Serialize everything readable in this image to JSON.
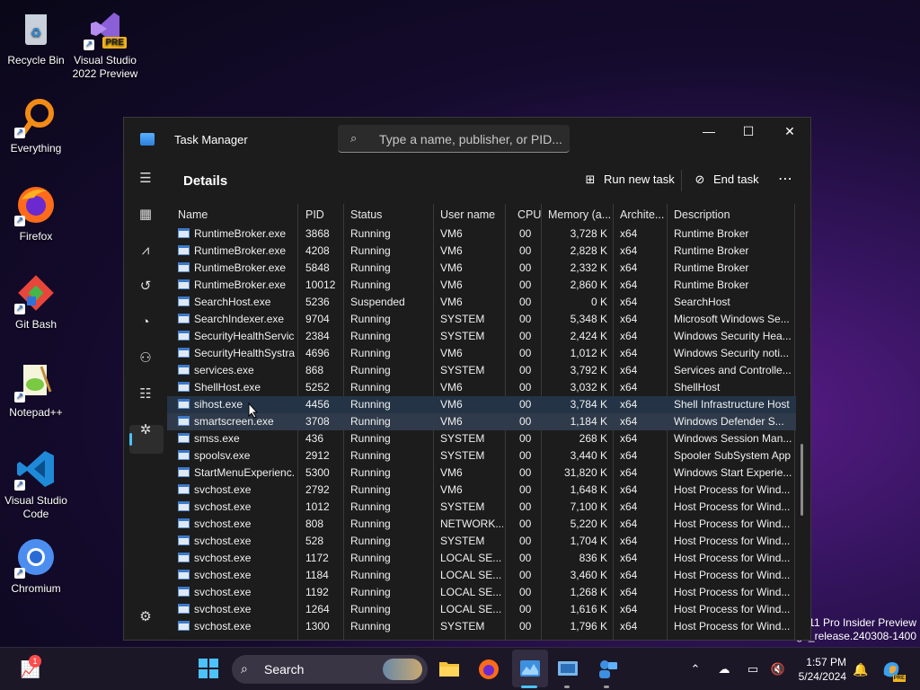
{
  "desktop": {
    "icons": [
      {
        "label": "Recycle Bin",
        "icon": "recycle-bin-icon"
      },
      {
        "label": "Visual Studio 2022 Preview",
        "icon": "visual-studio-preview-icon",
        "badge": "PRE"
      },
      {
        "label": "Everything",
        "icon": "everything-search-icon"
      },
      {
        "label": "Firefox",
        "icon": "firefox-icon"
      },
      {
        "label": "Git Bash",
        "icon": "git-bash-icon"
      },
      {
        "label": "Notepad++",
        "icon": "notepad-plus-plus-icon"
      },
      {
        "label": "Visual Studio Code",
        "icon": "vscode-icon"
      },
      {
        "label": "Chromium",
        "icon": "chromium-icon"
      }
    ],
    "watermark": {
      "line1": "11 Pro Insider Preview",
      "line2": "ge_release.240308-1400"
    }
  },
  "window": {
    "title": "Task Manager",
    "search_placeholder": "Type a name, publisher, or PID...",
    "controls": {
      "minimize": "—",
      "maximize": "☐",
      "close": "✕"
    }
  },
  "nav": {
    "items": [
      "hamburger-menu-icon",
      "processes-icon",
      "performance-icon",
      "app-history-icon",
      "startup-apps-icon",
      "users-icon",
      "details-icon",
      "services-icon"
    ],
    "active": "details-icon",
    "settings": "settings-icon"
  },
  "page": {
    "title": "Details",
    "run_new_task": "Run new task",
    "end_task": "End task",
    "more": "⋯"
  },
  "table": {
    "columns": [
      "Name",
      "PID",
      "Status",
      "User name",
      "CPU",
      "Memory (a...",
      "Archite...",
      "Description"
    ],
    "sort_column": "Name",
    "rows": [
      [
        "RuntimeBroker.exe",
        "3868",
        "Running",
        "VM6",
        "00",
        "3,728 K",
        "x64",
        "Runtime Broker"
      ],
      [
        "RuntimeBroker.exe",
        "4208",
        "Running",
        "VM6",
        "00",
        "2,828 K",
        "x64",
        "Runtime Broker"
      ],
      [
        "RuntimeBroker.exe",
        "5848",
        "Running",
        "VM6",
        "00",
        "2,332 K",
        "x64",
        "Runtime Broker"
      ],
      [
        "RuntimeBroker.exe",
        "10012",
        "Running",
        "VM6",
        "00",
        "2,860 K",
        "x64",
        "Runtime Broker"
      ],
      [
        "SearchHost.exe",
        "5236",
        "Suspended",
        "VM6",
        "00",
        "0 K",
        "x64",
        "SearchHost"
      ],
      [
        "SearchIndexer.exe",
        "9704",
        "Running",
        "SYSTEM",
        "00",
        "5,348 K",
        "x64",
        "Microsoft Windows Se..."
      ],
      [
        "SecurityHealthServic...",
        "2384",
        "Running",
        "SYSTEM",
        "00",
        "2,424 K",
        "x64",
        "Windows Security Hea..."
      ],
      [
        "SecurityHealthSystra...",
        "4696",
        "Running",
        "VM6",
        "00",
        "1,012 K",
        "x64",
        "Windows Security noti..."
      ],
      [
        "services.exe",
        "868",
        "Running",
        "SYSTEM",
        "00",
        "3,792 K",
        "x64",
        "Services and Controlle..."
      ],
      [
        "ShellHost.exe",
        "5252",
        "Running",
        "VM6",
        "00",
        "3,032 K",
        "x64",
        "ShellHost"
      ],
      [
        "sihost.exe",
        "4456",
        "Running",
        "VM6",
        "00",
        "3,784 K",
        "x64",
        "Shell Infrastructure Host"
      ],
      [
        "smartscreen.exe",
        "3708",
        "Running",
        "VM6",
        "00",
        "1,184 K",
        "x64",
        "Windows Defender S..."
      ],
      [
        "smss.exe",
        "436",
        "Running",
        "SYSTEM",
        "00",
        "268 K",
        "x64",
        "Windows Session Man..."
      ],
      [
        "spoolsv.exe",
        "2912",
        "Running",
        "SYSTEM",
        "00",
        "3,440 K",
        "x64",
        "Spooler SubSystem App"
      ],
      [
        "StartMenuExperienc...",
        "5300",
        "Running",
        "VM6",
        "00",
        "31,820 K",
        "x64",
        "Windows Start Experie..."
      ],
      [
        "svchost.exe",
        "2792",
        "Running",
        "VM6",
        "00",
        "1,648 K",
        "x64",
        "Host Process for Wind..."
      ],
      [
        "svchost.exe",
        "1012",
        "Running",
        "SYSTEM",
        "00",
        "7,100 K",
        "x64",
        "Host Process for Wind..."
      ],
      [
        "svchost.exe",
        "808",
        "Running",
        "NETWORK...",
        "00",
        "5,220 K",
        "x64",
        "Host Process for Wind..."
      ],
      [
        "svchost.exe",
        "528",
        "Running",
        "SYSTEM",
        "00",
        "1,704 K",
        "x64",
        "Host Process for Wind..."
      ],
      [
        "svchost.exe",
        "1172",
        "Running",
        "LOCAL SE...",
        "00",
        "836 K",
        "x64",
        "Host Process for Wind..."
      ],
      [
        "svchost.exe",
        "1184",
        "Running",
        "LOCAL SE...",
        "00",
        "3,460 K",
        "x64",
        "Host Process for Wind..."
      ],
      [
        "svchost.exe",
        "1192",
        "Running",
        "LOCAL SE...",
        "00",
        "1,268 K",
        "x64",
        "Host Process for Wind..."
      ],
      [
        "svchost.exe",
        "1264",
        "Running",
        "LOCAL SE...",
        "00",
        "1,616 K",
        "x64",
        "Host Process for Wind..."
      ],
      [
        "svchost.exe",
        "1300",
        "Running",
        "SYSTEM",
        "00",
        "1,796 K",
        "x64",
        "Host Process for Wind..."
      ]
    ],
    "hover_row_index": 10,
    "selected_row_index": 11
  },
  "taskbar": {
    "search_label": "Search",
    "widgets_badge": "1",
    "time": "1:57 PM",
    "date": "5/24/2024",
    "accent": "#4cc2ff"
  }
}
